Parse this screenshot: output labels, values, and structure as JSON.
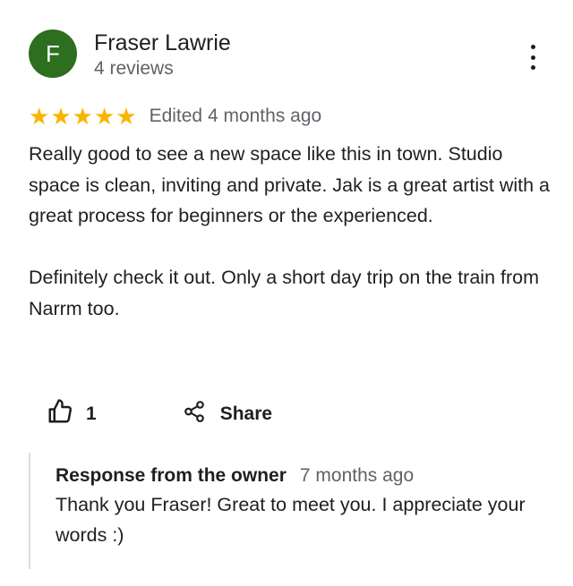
{
  "reviewer": {
    "initial": "F",
    "avatar_color": "#2e6e1f",
    "name": "Fraser Lawrie",
    "reviews": "4 reviews"
  },
  "more_menu_icon": "more-vertical-icon",
  "review": {
    "stars": 5,
    "star_color": "#f7b500",
    "edited": "Edited 4 months ago",
    "paragraphs": [
      "Really good to see a new space like this in town. Studio space is clean, inviting and private. Jak is  a great artist with a great process for beginners or the experienced.",
      "Definitely check it out. Only a short day trip on the train from Narrm too."
    ]
  },
  "actions": {
    "like_icon": "thumbs-up-icon",
    "like_count": "1",
    "share_icon": "share-icon",
    "share_label": "Share"
  },
  "owner_response": {
    "label": "Response from the owner",
    "time": "7 months ago",
    "text": "Thank you Fraser! Great to meet you. I appreciate your words :)"
  }
}
